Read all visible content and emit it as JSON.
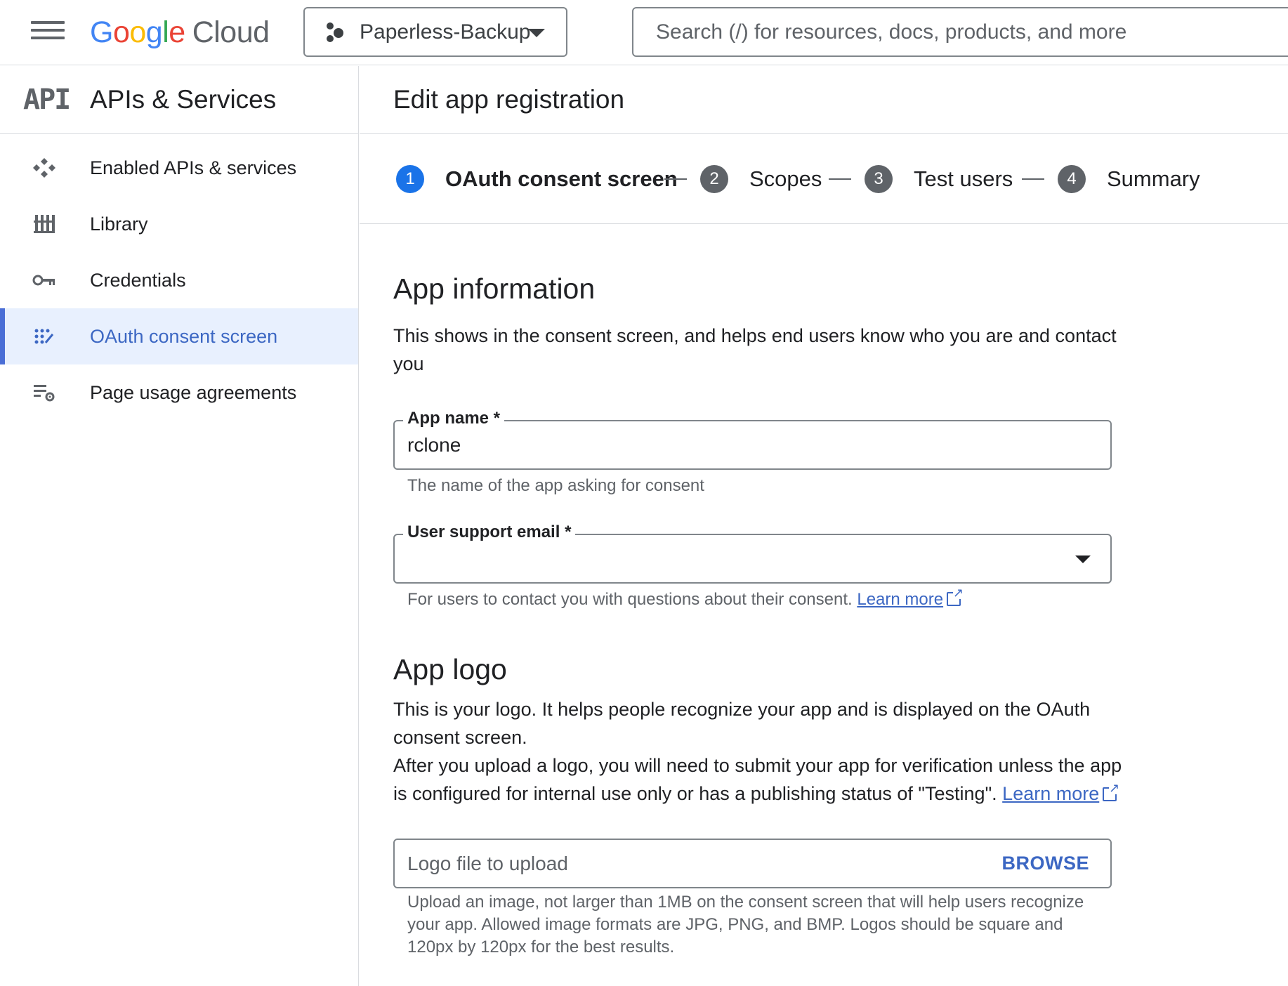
{
  "header": {
    "logo_letters": [
      "G",
      "o",
      "o",
      "g",
      "l",
      "e"
    ],
    "logo_cloud": "Cloud",
    "project": "Paperless-Backup",
    "search_placeholder": "Search (/) for resources, docs, products, and more"
  },
  "sidebar": {
    "icon_text": "API",
    "title": "APIs & Services",
    "items": [
      {
        "label": "Enabled APIs & services",
        "icon": "enabled-apis-icon",
        "active": false
      },
      {
        "label": "Library",
        "icon": "library-icon",
        "active": false
      },
      {
        "label": "Credentials",
        "icon": "key-icon",
        "active": false
      },
      {
        "label": "OAuth consent screen",
        "icon": "oauth-consent-icon",
        "active": true
      },
      {
        "label": "Page usage agreements",
        "icon": "settings-list-icon",
        "active": false
      }
    ]
  },
  "main": {
    "title": "Edit app registration",
    "steps": [
      {
        "num": "1",
        "label": "OAuth consent screen",
        "active": true
      },
      {
        "num": "2",
        "label": "Scopes",
        "active": false
      },
      {
        "num": "3",
        "label": "Test users",
        "active": false
      },
      {
        "num": "4",
        "label": "Summary",
        "active": false
      }
    ],
    "app_info": {
      "heading": "App information",
      "description_line1": "This shows in the consent screen, and helps end users know who you are and contact",
      "description_line2": "you",
      "app_name_label": "App name *",
      "app_name_value": "rclone",
      "app_name_hint": "The name of the app asking for consent",
      "email_label": "User support email *",
      "email_value": "",
      "email_hint": "For users to contact you with questions about their consent.",
      "learn_more": "Learn more"
    },
    "app_logo": {
      "heading": "App logo",
      "line1": "This is your logo. It helps people recognize your app and is displayed on the OAuth",
      "line2": "consent screen.",
      "line3": "After you upload a logo, you will need to submit your app for verification unless the app",
      "line4": "is configured for internal use only or has a publishing status of \"Testing\".",
      "learn_more": "Learn more",
      "upload_placeholder": "Logo file to upload",
      "browse": "BROWSE",
      "hint_line1": "Upload an image, not larger than 1MB on the consent screen that will help users recognize",
      "hint_line2": "your app. Allowed image formats are JPG, PNG, and BMP. Logos should be square and",
      "hint_line3": "120px by 120px for the best results."
    }
  },
  "colors": {
    "accent_blue": "#1a73e8",
    "link_blue": "#3c67c3",
    "active_bg": "#e8f0fe",
    "border": "#dadce0"
  }
}
